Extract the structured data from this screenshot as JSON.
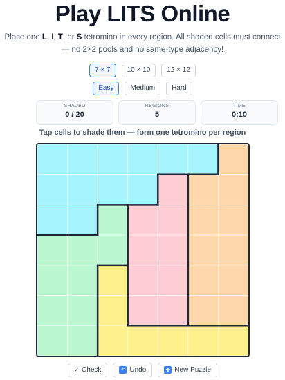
{
  "title": "Play LITS Online",
  "subtitle": {
    "pre": "Place one ",
    "l": "L",
    "sep1": ", ",
    "i": "I",
    "sep2": ", ",
    "t": "T",
    "sep3": ", or ",
    "s": "S",
    "line1_rest": " tetromino in every region. All shaded cells must connect",
    "line2": "— no 2×2 pools and no same-type adjacency!"
  },
  "sizes": [
    {
      "label": "7 × 7",
      "active": true
    },
    {
      "label": "10 × 10",
      "active": false
    },
    {
      "label": "12 × 12",
      "active": false
    }
  ],
  "difficulties": [
    {
      "label": "Easy",
      "active": true
    },
    {
      "label": "Medium",
      "active": false
    },
    {
      "label": "Hard",
      "active": false
    }
  ],
  "stats": {
    "shaded": {
      "label": "SHADED",
      "value": "0 / 20"
    },
    "regions": {
      "label": "REGIONS",
      "value": "5"
    },
    "time": {
      "label": "TIME",
      "value": "0:10"
    }
  },
  "hint": "Tap cells to shade them — form one tetromino per region",
  "board": {
    "rows": 7,
    "cols": 7,
    "region_colors": {
      "A": "#a5f3fc",
      "B": "#fed7aa",
      "C": "#fecdd3",
      "D": "#bbf7d0",
      "E": "#fef08a"
    },
    "regions": [
      "AAAAAAB",
      "AAAACBB",
      "AADCCBB",
      "DDDCCBB",
      "DDECCBB",
      "DDECCBB",
      "DDEEEEE"
    ],
    "shaded": []
  },
  "buttons": {
    "check": "✓ Check",
    "undo": "Undo",
    "new_puzzle": "New Puzzle"
  }
}
